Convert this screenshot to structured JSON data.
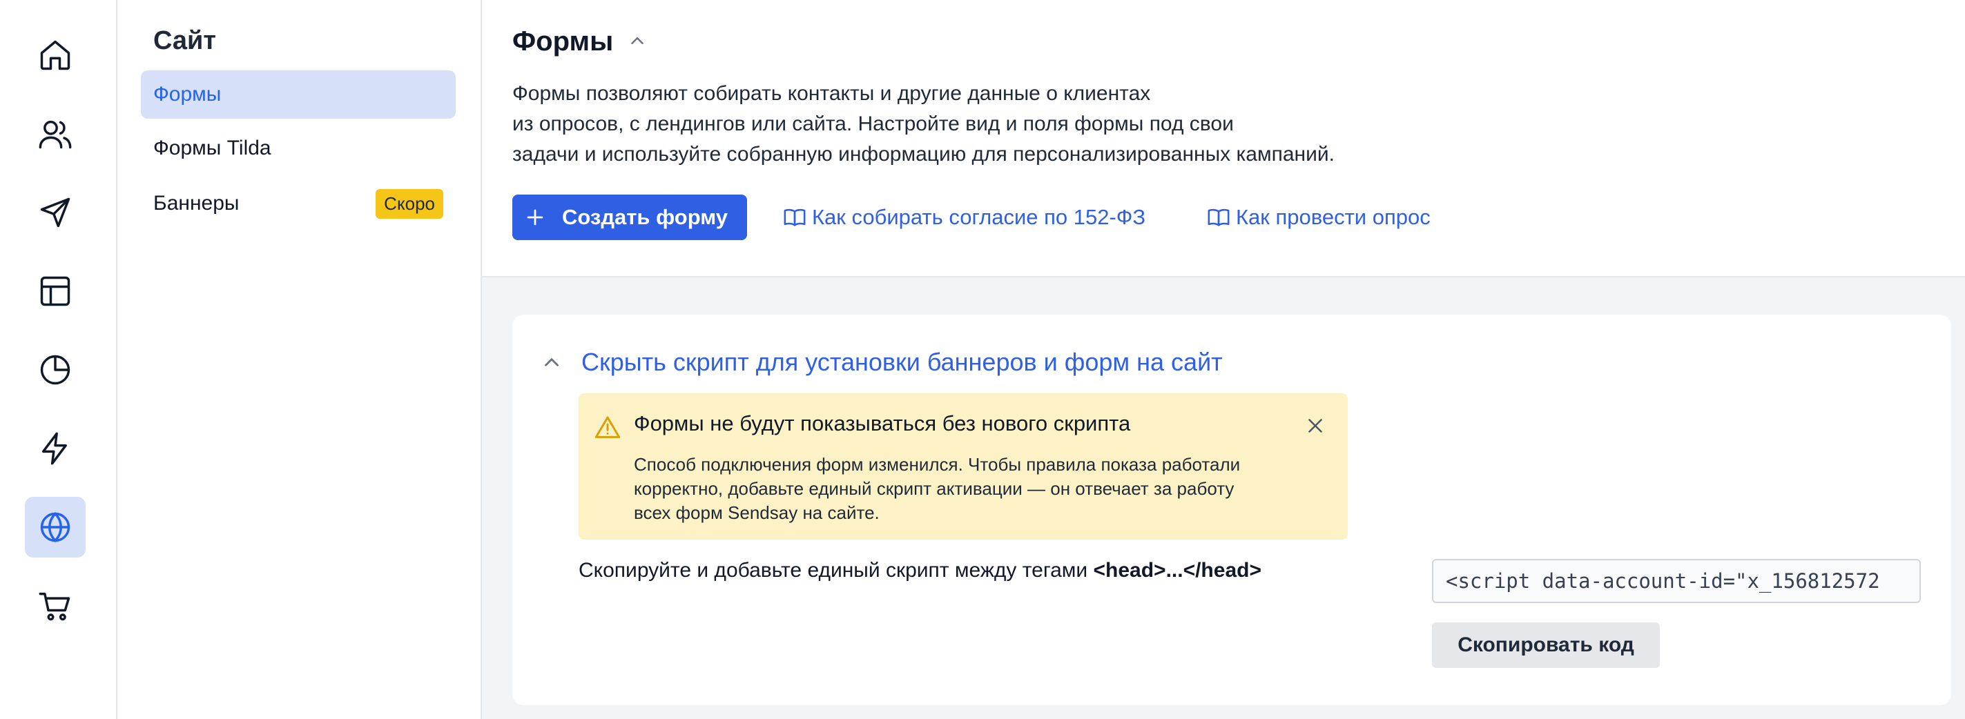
{
  "rail": {
    "items": [
      {
        "icon": "home-icon",
        "active": false
      },
      {
        "icon": "users-icon",
        "active": false
      },
      {
        "icon": "send-icon",
        "active": false
      },
      {
        "icon": "layout-icon",
        "active": false
      },
      {
        "icon": "pie-chart-icon",
        "active": false
      },
      {
        "icon": "lightning-icon",
        "active": false
      },
      {
        "icon": "globe-icon",
        "active": true
      },
      {
        "icon": "cart-icon",
        "active": false
      }
    ]
  },
  "sidebar": {
    "title": "Сайт",
    "items": [
      {
        "label": "Формы",
        "active": true
      },
      {
        "label": "Формы Tilda",
        "active": false
      },
      {
        "label": "Баннеры",
        "active": false,
        "badge": "Скоро"
      }
    ]
  },
  "header": {
    "title": "Формы",
    "description": [
      "Формы позволяют собирать контакты и другие данные о клиентах",
      "из опросов, с лендингов или сайта. Настройте вид и поля формы под свои",
      "задачи и используйте собранную информацию для персонализированных кампаний."
    ],
    "create_button": "Создать форму",
    "links": [
      {
        "label": "Как собирать согласие по 152-ФЗ",
        "icon": "book-icon"
      },
      {
        "label": "Как провести опрос",
        "icon": "book-icon"
      }
    ]
  },
  "script_card": {
    "toggle_label": "Скрыть скрипт для установки баннеров и форм на сайт",
    "alert": {
      "title": "Формы не будут показываться без нового скрипта",
      "body": [
        "Способ подключения форм изменился. Чтобы правила показа работали",
        "корректно, добавьте единый скрипт активации — он отвечает за работу",
        "всех форм Sendsay на сайте."
      ]
    },
    "instruction_prefix": "Скопируйте и добавьте единый скрипт между тегами ",
    "instruction_tags": "<head>...</head>",
    "code_value": "<script data-account-id=\"x_156812572",
    "copy_button": "Скопировать код"
  },
  "colors": {
    "accent": "#2f5fe3",
    "active_bg": "#d6e0f8",
    "alert_bg": "#fdf2c6",
    "badge_bg": "#f5c518"
  }
}
